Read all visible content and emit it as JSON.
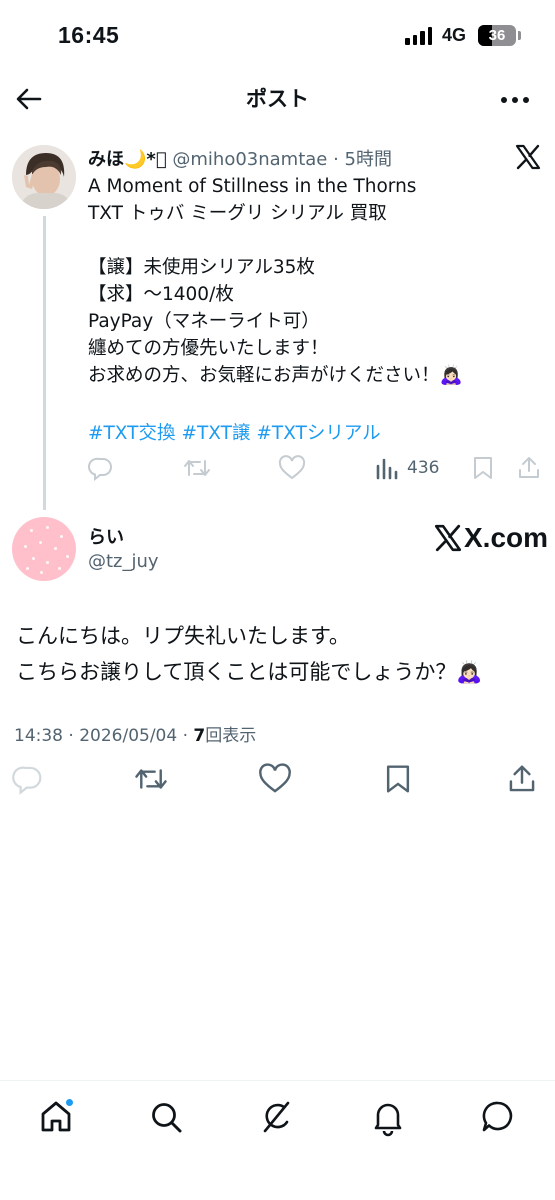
{
  "status_bar": {
    "time": "16:45",
    "network": "4G",
    "battery": "36",
    "battery_level_percent": 36
  },
  "header": {
    "title": "ポスト",
    "back_icon": "arrow-left-icon",
    "more_icon": "more-horizontal-icon"
  },
  "post": {
    "author_name": "みほ🌙*ﾟ",
    "author_handle": "@miho03namtae",
    "separator": " · ",
    "time_ago": "5時間",
    "body": "A Moment of Stillness in the Thorns\nTXT トゥバ ミーグリ シリアル 買取\n\n【譲】未使用シリアル35枚\n【求】〜1400/枚\nPayPay（マネーライト可）\n纏めての方優先いたします！\nお求めの方、お気軽にお声がけください！🙇🏻‍♀️",
    "hashtags": [
      "#TXT交換",
      "#TXT譲",
      "#TXTシリアル"
    ],
    "views": "436",
    "brand_icon": "x-logo-icon"
  },
  "reply": {
    "author_name": "らい",
    "author_handle": "@tz_juy",
    "watermark": "X.com",
    "body": "こんにちは。リプ失礼いたします。\nこちらお譲りして頂くことは可能でしょうか？🙇🏻‍♀️",
    "timestamp": "14:38 · 2026/05/04 · ",
    "view_count": "7",
    "view_label": "回表示"
  },
  "bottom_nav": {
    "items": [
      "home-icon",
      "search-icon",
      "grok-icon",
      "notifications-icon",
      "messages-icon"
    ]
  },
  "colors": {
    "accent": "#1d9bf0",
    "text": "#0f1419",
    "secondary": "#536471",
    "avatar_pink": "#ffc0cb"
  }
}
